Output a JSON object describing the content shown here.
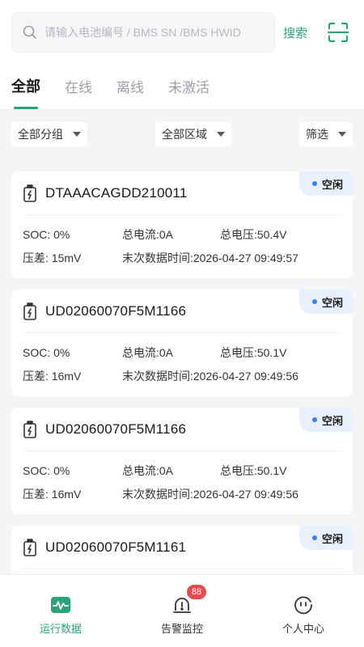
{
  "search": {
    "placeholder": "请输入电池编号 / BMS SN /BMS HWID",
    "button_label": "搜索"
  },
  "tabs": [
    {
      "label": "全部",
      "active": true
    },
    {
      "label": "在线",
      "active": false
    },
    {
      "label": "离线",
      "active": false
    },
    {
      "label": "未激活",
      "active": false
    }
  ],
  "filters": {
    "group": "全部分组",
    "region": "全部区域",
    "filter": "筛选"
  },
  "labels": {
    "soc": "SOC:",
    "current": "总电流:",
    "voltage": "总电压:",
    "diff": "压差:",
    "last_time": "末次数据时间:"
  },
  "batteries": [
    {
      "id": "DTAAACAGDD210011",
      "status": "空闲",
      "soc": "0%",
      "current": "0A",
      "voltage": "50.4V",
      "diff": "15mV",
      "last_time": "2026-04-27 09:49:57"
    },
    {
      "id": "UD02060070F5M1166",
      "status": "空闲",
      "soc": "0%",
      "current": "0A",
      "voltage": "50.1V",
      "diff": "16mV",
      "last_time": "2026-04-27 09:49:56"
    },
    {
      "id": "UD02060070F5M1166",
      "status": "空闲",
      "soc": "0%",
      "current": "0A",
      "voltage": "50.1V",
      "diff": "16mV",
      "last_time": "2026-04-27 09:49:56"
    },
    {
      "id": "UD02060070F5M1161",
      "status": "空闲",
      "soc": "",
      "current": "",
      "voltage": "",
      "diff": "",
      "last_time": ""
    }
  ],
  "tabbar": {
    "running": "运行数据",
    "alarm": "告警监控",
    "alarm_badge": "88",
    "profile": "个人中心"
  },
  "colors": {
    "accent": "#2aa37a",
    "status_dot": "#3d7ee8",
    "status_bg": "#e8f1fb",
    "badge": "#e5484d"
  }
}
